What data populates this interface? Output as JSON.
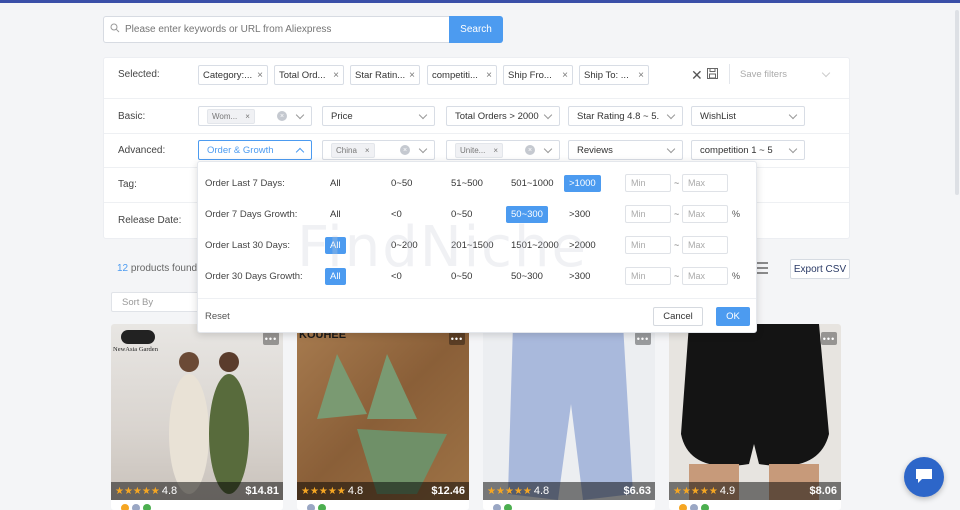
{
  "search": {
    "placeholder": "Please enter keywords or URL from Aliexpress",
    "button": "Search"
  },
  "filters": {
    "selected_label": "Selected:",
    "selected_chips": [
      "Category:...",
      "Total Ord...",
      "Star Ratin...",
      "competiti...",
      "Ship Fro...",
      "Ship To: ..."
    ],
    "save_filters": "Save filters",
    "basic_label": "Basic:",
    "basic": {
      "category_tag": "Wom...",
      "price": "Price",
      "total_orders": "Total Orders > 2000",
      "star_rating": "Star Rating 4.8 ~ 5.",
      "wishlist": "WishList"
    },
    "advanced_label": "Advanced:",
    "advanced": {
      "order_growth": "Order & Growth",
      "ship_from_tag": "China",
      "ship_to_tag": "Unite...",
      "reviews": "Reviews",
      "competition": "competition 1 ~ 5"
    },
    "tag_label": "Tag:",
    "release_label": "Release Date:"
  },
  "popup": {
    "rows": [
      {
        "label": "Order Last 7 Days:",
        "options": [
          "All",
          "0~50",
          "51~500",
          "501~1000",
          ">1000"
        ],
        "active": 4,
        "pct": false
      },
      {
        "label": "Order 7 Days Growth:",
        "options": [
          "All",
          "<0",
          "0~50",
          "50~300",
          ">300"
        ],
        "active": 3,
        "pct": true
      },
      {
        "label": "Order Last 30 Days:",
        "options": [
          "All",
          "0~200",
          "201~1500",
          "1501~2000",
          ">2000"
        ],
        "active": 0,
        "pct": false
      },
      {
        "label": "Order 30 Days Growth:",
        "options": [
          "All",
          "<0",
          "0~50",
          "50~300",
          ">300"
        ],
        "active": 0,
        "pct": true
      }
    ],
    "min_placeholder": "Min",
    "max_placeholder": "Max",
    "tilde": "~",
    "pct_sign": "%",
    "reset": "Reset",
    "cancel": "Cancel",
    "ok": "OK"
  },
  "results": {
    "count": "12",
    "count_suffix": "products found",
    "sort_by": "Sort By",
    "export": "Export CSV"
  },
  "watermark": "FindNiche",
  "cards": [
    {
      "brand": "NewAsia Garden",
      "rating": "4.8",
      "price": "$14.81"
    },
    {
      "brand": "KOUHEE",
      "rating": "4.8",
      "price": "$12.46"
    },
    {
      "brand": "",
      "rating": "4.8",
      "price": "$6.63"
    },
    {
      "brand": "",
      "rating": "4.9",
      "price": "$8.06"
    }
  ],
  "colors": {
    "accent": "#4c9bf0",
    "header": "#3a4fa8",
    "star": "#f5a623"
  }
}
